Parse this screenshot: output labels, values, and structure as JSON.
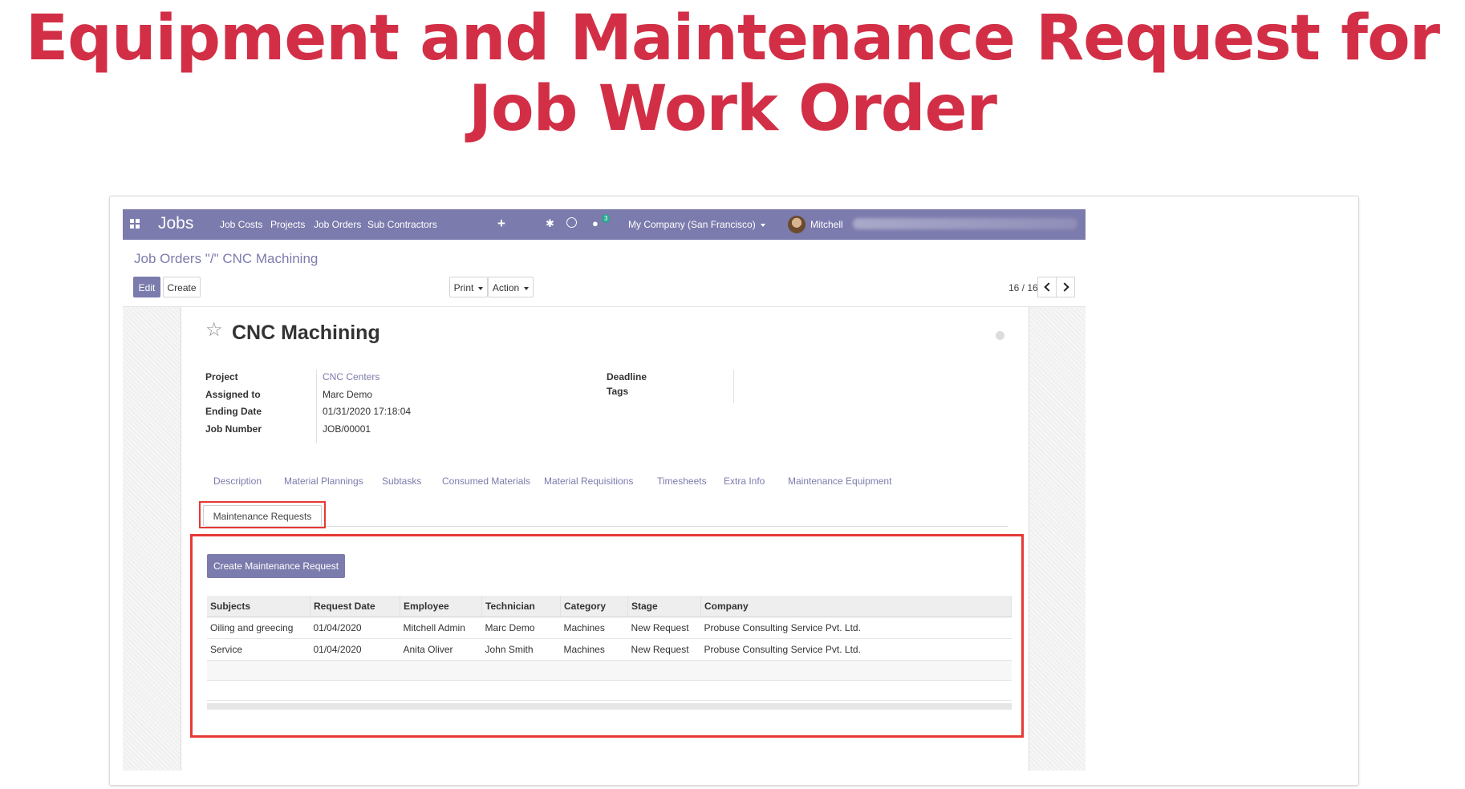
{
  "headline": "Equipment and Maintenance Request for Job Work Order",
  "colors": {
    "accent": "#d22f47",
    "brand": "#7c7bad",
    "highlight": "#e53935"
  },
  "navbar": {
    "app_name": "Jobs",
    "menu": [
      "Job Costs",
      "Projects",
      "Job Orders",
      "Sub Contractors"
    ],
    "chat_badge": "3",
    "company": "My Company (San Francisco)",
    "user": "Mitchell",
    "icons": [
      "apps-icon",
      "plus-icon",
      "bug-icon",
      "clock-icon",
      "chat-icon"
    ]
  },
  "breadcrumb": "Job Orders \"/\" CNC Machining",
  "toolbar": {
    "edit": "Edit",
    "create": "Create",
    "print": "Print",
    "action": "Action"
  },
  "pager": {
    "value": "16 / 16"
  },
  "record": {
    "title": "CNC Machining",
    "fields": [
      {
        "label": "Project",
        "value": "CNC Centers"
      },
      {
        "label": "Assigned to",
        "value": "Marc Demo"
      },
      {
        "label": "Ending Date",
        "value": "01/31/2020 17:18:04"
      },
      {
        "label": "Job Number",
        "value": "JOB/00001"
      }
    ],
    "right_fields": [
      {
        "label": "Deadline",
        "value": ""
      },
      {
        "label": "Tags",
        "value": ""
      }
    ]
  },
  "tabs": [
    "Description",
    "Material Plannings",
    "Subtasks",
    "Consumed Materials",
    "Material Requisitions",
    "Timesheets",
    "Extra Info",
    "Maintenance Equipment"
  ],
  "active_tab": "Maintenance Requests",
  "maintenance": {
    "create_button": "Create Maintenance Request",
    "columns": [
      "Subjects",
      "Request Date",
      "Employee",
      "Technician",
      "Category",
      "Stage",
      "Company"
    ],
    "rows": [
      [
        "Oiling and greecing",
        "01/04/2020",
        "Mitchell Admin",
        "Marc Demo",
        "Machines",
        "New Request",
        "Probuse Consulting Service Pvt. Ltd."
      ],
      [
        "Service",
        "01/04/2020",
        "Anita Oliver",
        "John Smith",
        "Machines",
        "New Request",
        "Probuse Consulting Service Pvt. Ltd."
      ]
    ]
  }
}
